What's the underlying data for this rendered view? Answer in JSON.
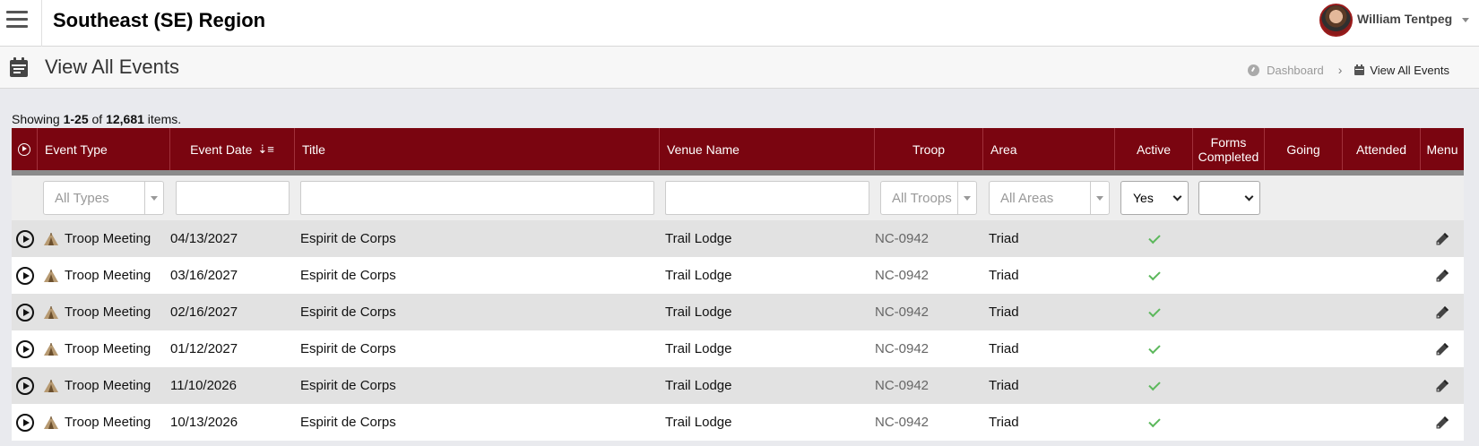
{
  "header": {
    "region_title": "Southeast (SE) Region",
    "user_name": "William Tentpeg"
  },
  "page": {
    "title": "View All Events",
    "breadcrumb": [
      "Dashboard",
      "View All Events"
    ]
  },
  "summary": {
    "prefix": "Showing ",
    "range": "1-25",
    "of": " of ",
    "total": "12,681",
    "suffix": " items."
  },
  "table": {
    "columns": [
      "Event Type",
      "Event Date",
      "Title",
      "Venue Name",
      "Troop",
      "Area",
      "Active",
      "Forms Completed",
      "Going",
      "Attended",
      "Menu"
    ],
    "filters": {
      "type_placeholder": "All Types",
      "troop_placeholder": "All Troops",
      "area_placeholder": "All Areas",
      "active_value": "Yes",
      "forms_value": ""
    },
    "rows": [
      {
        "type": "Troop Meeting",
        "date": "04/13/2027",
        "title": "Espirit de Corps",
        "venue": "Trail Lodge",
        "troop": "NC-0942",
        "area": "Triad",
        "active": true
      },
      {
        "type": "Troop Meeting",
        "date": "03/16/2027",
        "title": "Espirit de Corps",
        "venue": "Trail Lodge",
        "troop": "NC-0942",
        "area": "Triad",
        "active": true
      },
      {
        "type": "Troop Meeting",
        "date": "02/16/2027",
        "title": "Espirit de Corps",
        "venue": "Trail Lodge",
        "troop": "NC-0942",
        "area": "Triad",
        "active": true
      },
      {
        "type": "Troop Meeting",
        "date": "01/12/2027",
        "title": "Espirit de Corps",
        "venue": "Trail Lodge",
        "troop": "NC-0942",
        "area": "Triad",
        "active": true
      },
      {
        "type": "Troop Meeting",
        "date": "11/10/2026",
        "title": "Espirit de Corps",
        "venue": "Trail Lodge",
        "troop": "NC-0942",
        "area": "Triad",
        "active": true
      },
      {
        "type": "Troop Meeting",
        "date": "10/13/2026",
        "title": "Espirit de Corps",
        "venue": "Trail Lodge",
        "troop": "NC-0942",
        "area": "Triad",
        "active": true
      }
    ]
  },
  "colors": {
    "header_bg": "#7a0510",
    "check": "#5cb85c"
  }
}
